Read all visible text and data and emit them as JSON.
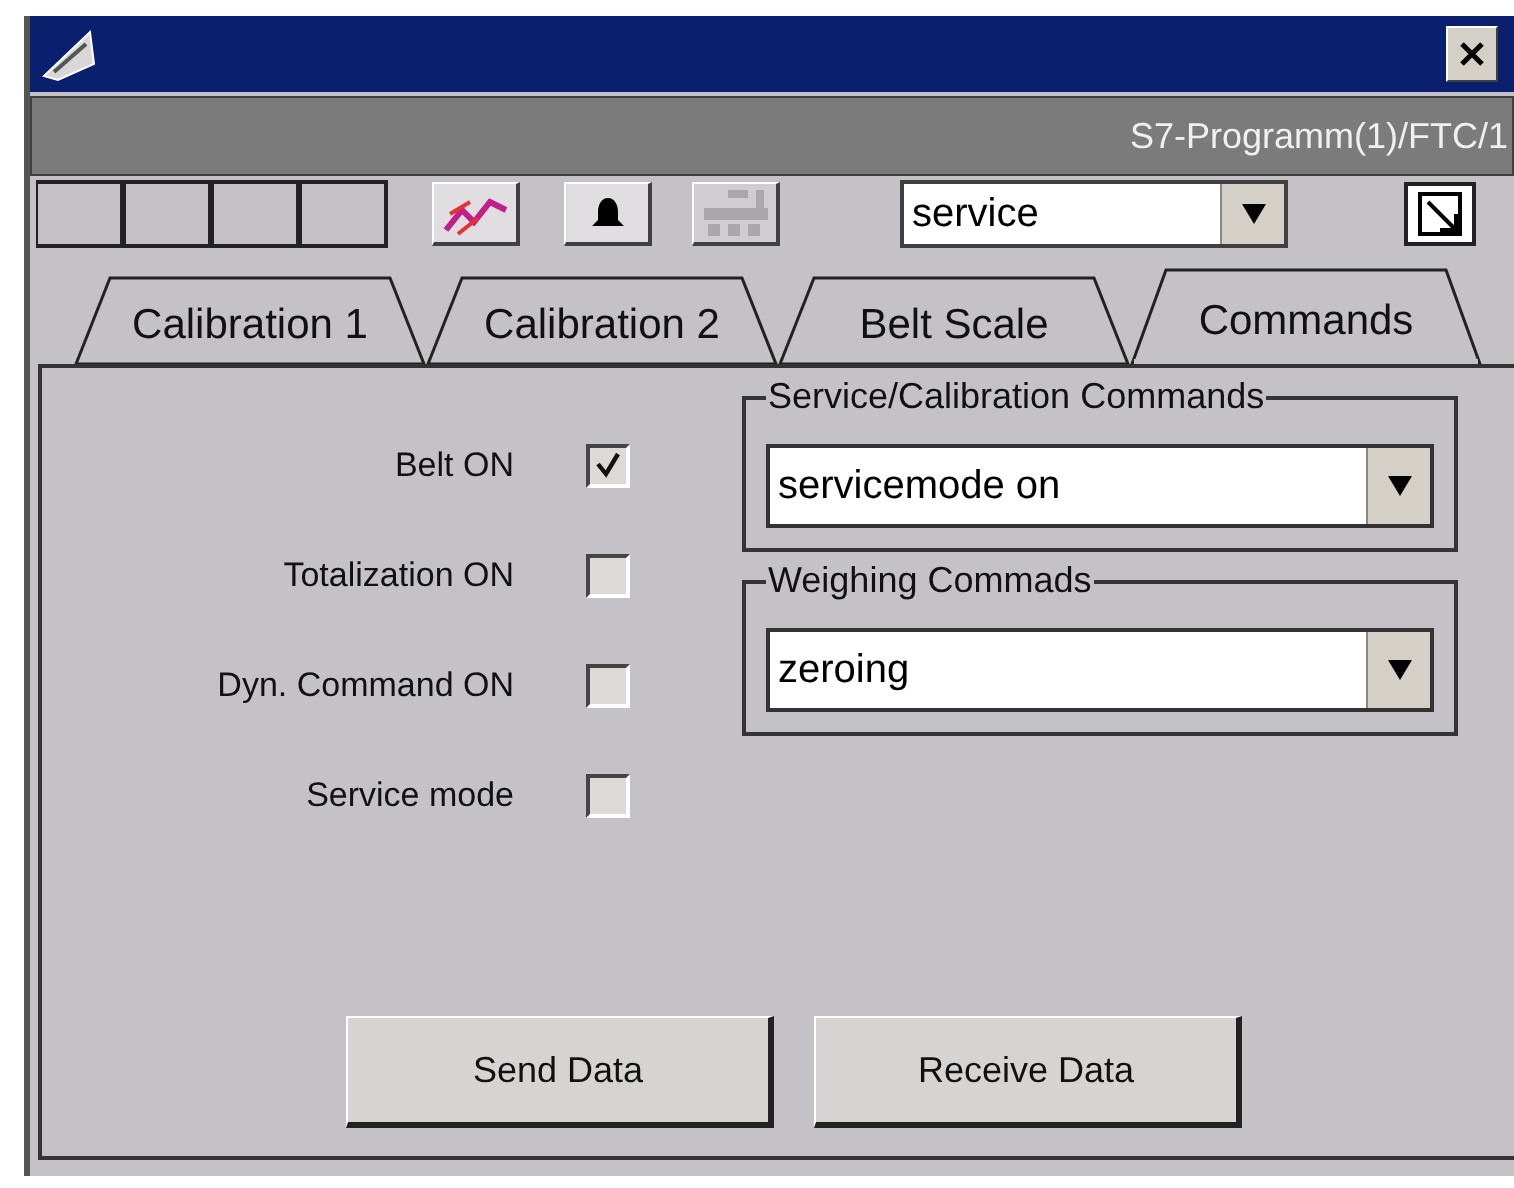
{
  "window": {
    "caption": "S7-Programm(1)/FTC/1"
  },
  "toolbar": {
    "slots": [
      {
        "kind": "empty"
      },
      {
        "kind": "empty"
      },
      {
        "kind": "empty"
      },
      {
        "kind": "empty"
      },
      {
        "kind": "chart",
        "disabled": false
      },
      {
        "kind": "bell",
        "disabled": false
      },
      {
        "kind": "machine",
        "disabled": true
      }
    ],
    "mode_select": {
      "value": "service"
    }
  },
  "tabs": [
    {
      "label": "Calibration 1",
      "selected": false
    },
    {
      "label": "Calibration 2",
      "selected": false
    },
    {
      "label": "Belt Scale",
      "selected": false
    },
    {
      "label": "Commands",
      "selected": true
    }
  ],
  "switches": [
    {
      "label": "Belt ON",
      "checked": true
    },
    {
      "label": "Totalization ON",
      "checked": false
    },
    {
      "label": "Dyn. Command ON",
      "checked": false
    },
    {
      "label": "Service mode",
      "checked": false
    }
  ],
  "groups": [
    {
      "title": "Service/Calibration Commands",
      "value": "servicemode on"
    },
    {
      "title": "Weighing Commads",
      "value": "zeroing"
    }
  ],
  "buttons": [
    "Send Data",
    "Receive Data"
  ]
}
